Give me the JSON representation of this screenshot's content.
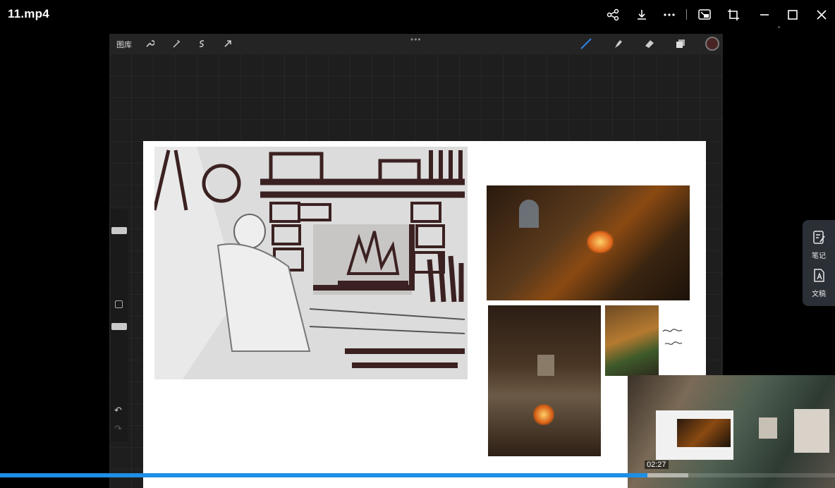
{
  "window": {
    "title": "11.mp4",
    "controls": [
      "share-icon",
      "download-icon",
      "more-icon",
      "picture-in-picture-icon",
      "crop-icon",
      "minimize-icon",
      "maximize-icon",
      "close-icon"
    ]
  },
  "procreate": {
    "gallery_label": "图库",
    "left_tools": [
      "wrench-icon",
      "magic-wand-icon",
      "selection-icon",
      "transform-arrow-icon"
    ],
    "right_tools": [
      "brush-icon",
      "smudge-icon",
      "eraser-icon",
      "layers-icon"
    ],
    "color": "#4a2424"
  },
  "side_panel": {
    "notes_label": "笔记",
    "transcript_label": "文稿"
  },
  "player": {
    "time_tooltip": "02:27",
    "progress": 0.775,
    "accent": "#1d8fe6"
  }
}
